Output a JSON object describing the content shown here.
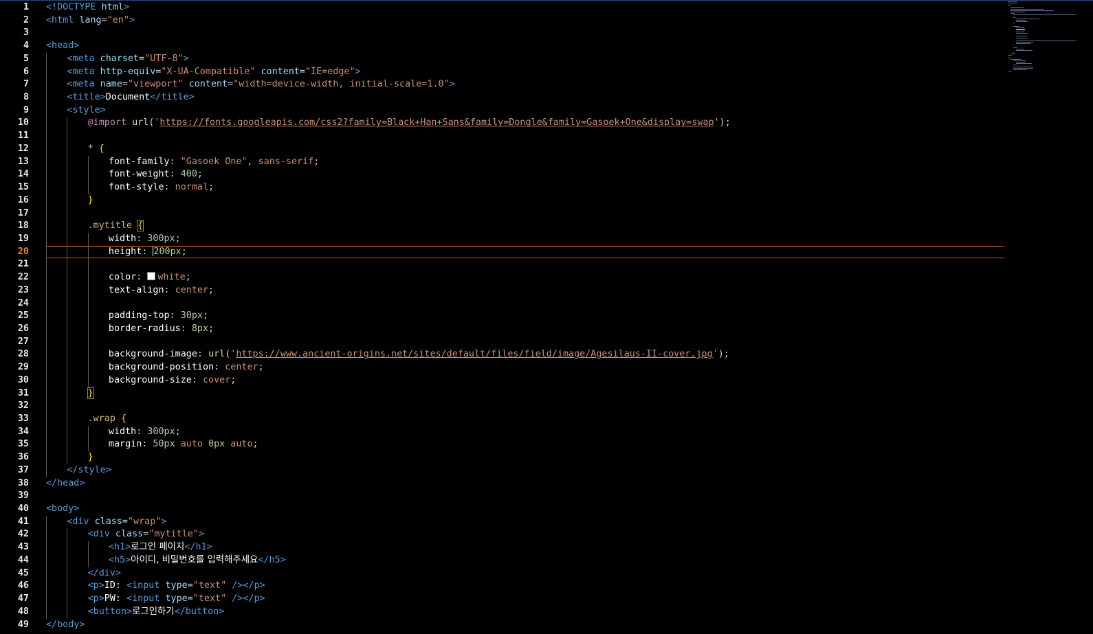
{
  "editor": {
    "active_line": 20,
    "lines": [
      {
        "n": 1,
        "indent": 0,
        "tokens": [
          [
            "doc",
            "<!DOCTYPE "
          ],
          [
            "attr",
            "html"
          ],
          [
            "doc",
            ">"
          ]
        ]
      },
      {
        "n": 2,
        "indent": 0,
        "tokens": [
          [
            "tag",
            "<html "
          ],
          [
            "attr",
            "lang"
          ],
          [
            "punc",
            "="
          ],
          [
            "str",
            "\"en\""
          ],
          [
            "tag",
            ">"
          ]
        ]
      },
      {
        "n": 3,
        "indent": 0,
        "tokens": []
      },
      {
        "n": 4,
        "indent": 0,
        "tokens": [
          [
            "tag",
            "<head>"
          ]
        ]
      },
      {
        "n": 5,
        "indent": 1,
        "tokens": [
          [
            "tag",
            "<meta "
          ],
          [
            "attr",
            "charset"
          ],
          [
            "punc",
            "="
          ],
          [
            "str",
            "\"UTF-8\""
          ],
          [
            "tag",
            ">"
          ]
        ]
      },
      {
        "n": 6,
        "indent": 1,
        "tokens": [
          [
            "tag",
            "<meta "
          ],
          [
            "attr",
            "http-equiv"
          ],
          [
            "punc",
            "="
          ],
          [
            "str",
            "\"X-UA-Compatible\""
          ],
          [
            "punc",
            " "
          ],
          [
            "attr",
            "content"
          ],
          [
            "punc",
            "="
          ],
          [
            "str",
            "\"IE=edge\""
          ],
          [
            "tag",
            ">"
          ]
        ]
      },
      {
        "n": 7,
        "indent": 1,
        "tokens": [
          [
            "tag",
            "<meta "
          ],
          [
            "attr",
            "name"
          ],
          [
            "punc",
            "="
          ],
          [
            "str",
            "\"viewport\""
          ],
          [
            "punc",
            " "
          ],
          [
            "attr",
            "content"
          ],
          [
            "punc",
            "="
          ],
          [
            "str",
            "\"width=device-width, initial-scale=1.0\""
          ],
          [
            "tag",
            ">"
          ]
        ]
      },
      {
        "n": 8,
        "indent": 1,
        "tokens": [
          [
            "tag",
            "<title>"
          ],
          [
            "txt",
            "Document"
          ],
          [
            "tag",
            "</title>"
          ]
        ]
      },
      {
        "n": 9,
        "indent": 1,
        "tokens": [
          [
            "tag",
            "<style>"
          ]
        ]
      },
      {
        "n": 10,
        "indent": 2,
        "tokens": [
          [
            "at",
            "@import"
          ],
          [
            "punc",
            " "
          ],
          [
            "fn",
            "url"
          ],
          [
            "punc",
            "("
          ],
          [
            "str",
            "'"
          ],
          [
            "url",
            "https://fonts.googleapis.com/css2?family=Black+Han+Sans&family=Dongle&family=Gasoek+One&display=swap"
          ],
          [
            "str",
            "'"
          ],
          [
            "punc",
            ");"
          ]
        ]
      },
      {
        "n": 11,
        "indent": 2,
        "tokens": []
      },
      {
        "n": 12,
        "indent": 2,
        "tokens": [
          [
            "sel",
            "* "
          ],
          [
            "brace",
            "{"
          ]
        ]
      },
      {
        "n": 13,
        "indent": 3,
        "tokens": [
          [
            "prop",
            "font-family"
          ],
          [
            "punc",
            ": "
          ],
          [
            "str",
            "\"Gasoek One\""
          ],
          [
            "punc",
            ", "
          ],
          [
            "kw",
            "sans-serif"
          ],
          [
            "punc",
            ";"
          ]
        ]
      },
      {
        "n": 14,
        "indent": 3,
        "tokens": [
          [
            "prop",
            "font-weight"
          ],
          [
            "punc",
            ": "
          ],
          [
            "num",
            "400"
          ],
          [
            "punc",
            ";"
          ]
        ]
      },
      {
        "n": 15,
        "indent": 3,
        "tokens": [
          [
            "prop",
            "font-style"
          ],
          [
            "punc",
            ": "
          ],
          [
            "kw",
            "normal"
          ],
          [
            "punc",
            ";"
          ]
        ]
      },
      {
        "n": 16,
        "indent": 2,
        "tokens": [
          [
            "brace",
            "}"
          ]
        ]
      },
      {
        "n": 17,
        "indent": 2,
        "tokens": []
      },
      {
        "n": 18,
        "indent": 2,
        "tokens": [
          [
            "sel",
            ".mytitle "
          ],
          [
            "bracebox",
            "{"
          ]
        ]
      },
      {
        "n": 19,
        "indent": 3,
        "tokens": [
          [
            "prop",
            "width"
          ],
          [
            "punc",
            ": "
          ],
          [
            "num",
            "300px"
          ],
          [
            "punc",
            ";"
          ]
        ]
      },
      {
        "n": 20,
        "indent": 3,
        "tokens": [
          [
            "prop",
            "height"
          ],
          [
            "punc",
            ": "
          ],
          [
            "cursor",
            ""
          ],
          [
            "num",
            "200px"
          ],
          [
            "punc",
            ";"
          ]
        ]
      },
      {
        "n": 21,
        "indent": 3,
        "tokens": []
      },
      {
        "n": 22,
        "indent": 3,
        "tokens": [
          [
            "prop",
            "color"
          ],
          [
            "punc",
            ": "
          ],
          [
            "swatch",
            ""
          ],
          [
            "kw",
            "white"
          ],
          [
            "punc",
            ";"
          ]
        ]
      },
      {
        "n": 23,
        "indent": 3,
        "tokens": [
          [
            "prop",
            "text-align"
          ],
          [
            "punc",
            ": "
          ],
          [
            "kw",
            "center"
          ],
          [
            "punc",
            ";"
          ]
        ]
      },
      {
        "n": 24,
        "indent": 3,
        "tokens": []
      },
      {
        "n": 25,
        "indent": 3,
        "tokens": [
          [
            "prop",
            "padding-top"
          ],
          [
            "punc",
            ": "
          ],
          [
            "num",
            "30px"
          ],
          [
            "punc",
            ";"
          ]
        ]
      },
      {
        "n": 26,
        "indent": 3,
        "tokens": [
          [
            "prop",
            "border-radius"
          ],
          [
            "punc",
            ": "
          ],
          [
            "num",
            "8px"
          ],
          [
            "punc",
            ";"
          ]
        ]
      },
      {
        "n": 27,
        "indent": 3,
        "tokens": []
      },
      {
        "n": 28,
        "indent": 3,
        "tokens": [
          [
            "prop",
            "background-image"
          ],
          [
            "punc",
            ": "
          ],
          [
            "fn",
            "url"
          ],
          [
            "punc",
            "("
          ],
          [
            "str",
            "'"
          ],
          [
            "url",
            "https://www.ancient-origins.net/sites/default/files/field/image/Agesilaus-II-cover.jpg"
          ],
          [
            "str",
            "'"
          ],
          [
            "punc",
            ");"
          ]
        ]
      },
      {
        "n": 29,
        "indent": 3,
        "tokens": [
          [
            "prop",
            "background-position"
          ],
          [
            "punc",
            ": "
          ],
          [
            "kw",
            "center"
          ],
          [
            "punc",
            ";"
          ]
        ]
      },
      {
        "n": 30,
        "indent": 3,
        "tokens": [
          [
            "prop",
            "background-size"
          ],
          [
            "punc",
            ": "
          ],
          [
            "kw",
            "cover"
          ],
          [
            "punc",
            ";"
          ]
        ]
      },
      {
        "n": 31,
        "indent": 2,
        "tokens": [
          [
            "bracebox",
            "}"
          ]
        ]
      },
      {
        "n": 32,
        "indent": 2,
        "tokens": []
      },
      {
        "n": 33,
        "indent": 2,
        "tokens": [
          [
            "sel",
            ".wrap "
          ],
          [
            "brace",
            "{"
          ]
        ]
      },
      {
        "n": 34,
        "indent": 3,
        "tokens": [
          [
            "prop",
            "width"
          ],
          [
            "punc",
            ": "
          ],
          [
            "num",
            "300px"
          ],
          [
            "punc",
            ";"
          ]
        ]
      },
      {
        "n": 35,
        "indent": 3,
        "tokens": [
          [
            "prop",
            "margin"
          ],
          [
            "punc",
            ": "
          ],
          [
            "num",
            "50px"
          ],
          [
            "punc",
            " "
          ],
          [
            "kw",
            "auto"
          ],
          [
            "punc",
            " "
          ],
          [
            "num",
            "0px"
          ],
          [
            "punc",
            " "
          ],
          [
            "kw",
            "auto"
          ],
          [
            "punc",
            ";"
          ]
        ]
      },
      {
        "n": 36,
        "indent": 2,
        "tokens": [
          [
            "brace",
            "}"
          ]
        ]
      },
      {
        "n": 37,
        "indent": 1,
        "tokens": [
          [
            "tag",
            "</style>"
          ]
        ]
      },
      {
        "n": 38,
        "indent": 0,
        "tokens": [
          [
            "tag",
            "</head>"
          ]
        ]
      },
      {
        "n": 39,
        "indent": 0,
        "tokens": []
      },
      {
        "n": 40,
        "indent": 0,
        "tokens": [
          [
            "tag",
            "<body>"
          ]
        ]
      },
      {
        "n": 41,
        "indent": 1,
        "tokens": [
          [
            "tag",
            "<div "
          ],
          [
            "attr",
            "class"
          ],
          [
            "punc",
            "="
          ],
          [
            "str",
            "\"wrap\""
          ],
          [
            "tag",
            ">"
          ]
        ]
      },
      {
        "n": 42,
        "indent": 2,
        "tokens": [
          [
            "tag",
            "<div "
          ],
          [
            "attr",
            "class"
          ],
          [
            "punc",
            "="
          ],
          [
            "str",
            "\"mytitle\""
          ],
          [
            "tag",
            ">"
          ]
        ]
      },
      {
        "n": 43,
        "indent": 3,
        "tokens": [
          [
            "tag",
            "<h1>"
          ],
          [
            "kor",
            "로그인 페이지"
          ],
          [
            "tag",
            "</h1>"
          ]
        ]
      },
      {
        "n": 44,
        "indent": 3,
        "tokens": [
          [
            "tag",
            "<h5>"
          ],
          [
            "kor",
            "아이디, 비밀번호를 입력해주세요"
          ],
          [
            "tag",
            "</h5>"
          ]
        ]
      },
      {
        "n": 45,
        "indent": 2,
        "tokens": [
          [
            "tag",
            "</div>"
          ]
        ]
      },
      {
        "n": 46,
        "indent": 2,
        "tokens": [
          [
            "tag",
            "<p>"
          ],
          [
            "txt",
            "ID: "
          ],
          [
            "tag",
            "<input "
          ],
          [
            "attr",
            "type"
          ],
          [
            "punc",
            "="
          ],
          [
            "str",
            "\"text\""
          ],
          [
            "punc",
            " "
          ],
          [
            "tag",
            "/></p>"
          ]
        ]
      },
      {
        "n": 47,
        "indent": 2,
        "tokens": [
          [
            "tag",
            "<p>"
          ],
          [
            "txt",
            "PW: "
          ],
          [
            "tag",
            "<input "
          ],
          [
            "attr",
            "type"
          ],
          [
            "punc",
            "="
          ],
          [
            "str",
            "\"text\""
          ],
          [
            "punc",
            " "
          ],
          [
            "tag",
            "/></p>"
          ]
        ]
      },
      {
        "n": 48,
        "indent": 2,
        "tokens": [
          [
            "tag",
            "<button>"
          ],
          [
            "kor",
            "로그인하기"
          ],
          [
            "tag",
            "</button>"
          ]
        ]
      },
      {
        "n": 49,
        "indent": 0,
        "tokens": [
          [
            "tag",
            "</body>"
          ]
        ]
      }
    ]
  },
  "colors": {
    "background": "#000000",
    "active_line_border": "#c86a1a",
    "active_line_number": "#e68a2e",
    "tag": "#569cd6",
    "attribute": "#9cdcfe",
    "string": "#ce9178",
    "number": "#b5cea8",
    "selector": "#d7ba7d",
    "brace": "#ffd700"
  }
}
